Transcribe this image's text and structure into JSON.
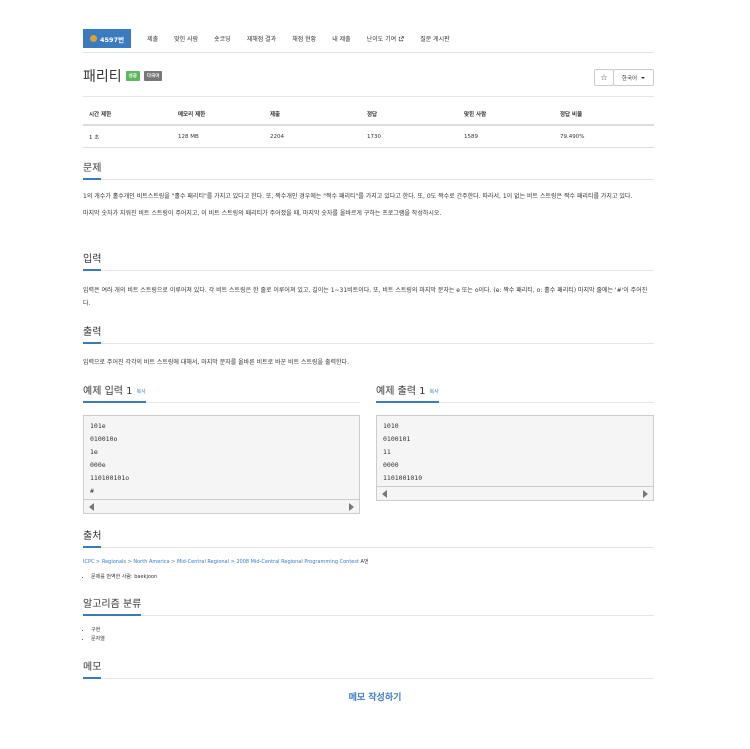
{
  "nav": {
    "user_id": "4597번",
    "items": [
      "제출",
      "맞힌 사람",
      "숏코딩",
      "재채점 결과",
      "채점 현황",
      "내 제출",
      "난이도 기여",
      "질문 게시판"
    ]
  },
  "problem": {
    "title": "패리티",
    "badge_success": "성공",
    "badge_lang": "다국어",
    "star": "☆",
    "language": "한국어"
  },
  "stats": {
    "headers": [
      "시간 제한",
      "메모리 제한",
      "제출",
      "정답",
      "맞힌 사람",
      "정답 비율"
    ],
    "values": [
      "1 초",
      "128 MB",
      "2204",
      "1730",
      "1589",
      "79.490%"
    ]
  },
  "sections": {
    "problem": "문제",
    "input": "입력",
    "output": "출력",
    "source": "출처",
    "algorithm": "알고리즘 분류",
    "memo": "메모"
  },
  "problem_text": {
    "p1": "1의 개수가 홀수개인 비트스트링을 \"홀수 패리티\"를 가지고 있다고 한다. 또, 짝수개인 경우에는 \"짝수 패리티\"를 가지고 있다고 한다. 또, 0도 짝수로 간주한다. 따라서, 1이 없는 비트 스트링은 짝수 패리티를 가지고 있다.",
    "p2": "마지막 숫자가 지워진 비트 스트링이 주어지고, 이 비트 스트링의 패리티가 주어졌을 때, 마지막 숫자를 올바르게 구하는 프로그램을 작성하시오."
  },
  "input_text": "입력은 여러 개의 비트 스트링으로 이루어져 있다. 각 비트 스트링은 한 줄로 이루어져 있고, 길이는 1~31비트이다. 또, 비트 스트링의 마지막 문자는 e 또는 o이다. (e: 짝수 패리티, o: 홀수 패리티) 마지막 줄에는 '#'이 주어진다.",
  "output_text": "입력으로 주어진 각각의 비트 스트링에 대해서, 마지막 문자를 올바른 비트로 바꾼 비트 스트링을 출력한다.",
  "sample_input": {
    "title": "예제 입력 1",
    "copy": "복사",
    "lines": [
      "101e",
      "010010o",
      "1e",
      "000e",
      "110100101o",
      "#"
    ]
  },
  "sample_output": {
    "title": "예제 출력 1",
    "copy": "복사",
    "lines": [
      "1010",
      "0100101",
      "11",
      "0000",
      "1101001010"
    ]
  },
  "source": {
    "path": "ICPC > Regionals > North America > Mid-Central Regional > 2008 Mid-Central Regional Programming Contest",
    "suffix": "A번",
    "translator": "문제를 번역한 사람: baekjoon"
  },
  "algorithms": [
    "구현",
    "문자열"
  ],
  "memo_link": "메모 작성하기"
}
